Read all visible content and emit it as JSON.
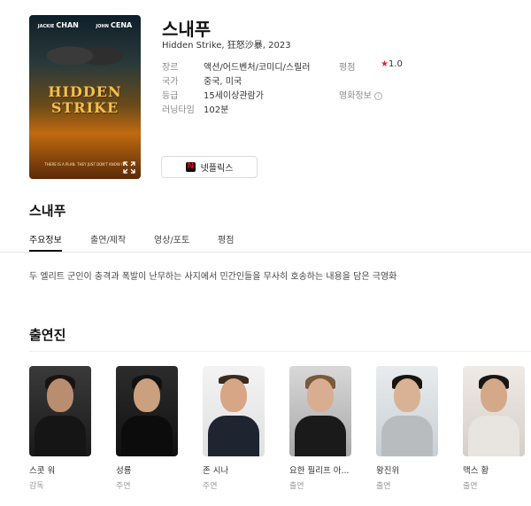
{
  "movie": {
    "title": "스내푸",
    "subtitle": "Hidden Strike, 狂怒沙暴, 2023"
  },
  "poster": {
    "actor_left_first": "JACKIE",
    "actor_left_last": "CHAN",
    "actor_right_first": "JOHN",
    "actor_right_last": "CENA",
    "title_line1": "HIDDEN",
    "title_line2": "STRIKE",
    "tagline": "THERE IS A PLAN. THEY JUST DON'T KNOW IT."
  },
  "meta": {
    "genre_label": "장르",
    "genre_value": "액션/어드벤처/코미디/스릴러",
    "rating_label": "평점",
    "rating_value": "1.0",
    "country_label": "국가",
    "country_value": "중국, 미국",
    "grade_label": "등급",
    "grade_value": "15세이상관람가",
    "movie_info_label": "영화정보",
    "runtime_label": "러닝타임",
    "runtime_value": "102분"
  },
  "watch": {
    "netflix_label": "넷플릭스"
  },
  "section_title": "스내푸",
  "tabs": [
    {
      "label": "주요정보"
    },
    {
      "label": "출연/제작"
    },
    {
      "label": "영상/포토"
    },
    {
      "label": "평점"
    }
  ],
  "synopsis": "두 엘리트 군인이 충격과 폭발이 난무하는 사지에서 민간인들을 무사히 호송하는 내용을 담은 극영화",
  "cast_title": "출연진",
  "cast": [
    {
      "name": "스콧 워",
      "role": "감독"
    },
    {
      "name": "성룡",
      "role": "주연"
    },
    {
      "name": "존 시나",
      "role": "주연"
    },
    {
      "name": "요한 필리프 아...",
      "role": "출연"
    },
    {
      "name": "왕진위",
      "role": "출연"
    },
    {
      "name": "맥스 황",
      "role": "출연"
    }
  ],
  "colors": {
    "rating_star": "#e5252a",
    "netflix_red": "#e50914"
  }
}
